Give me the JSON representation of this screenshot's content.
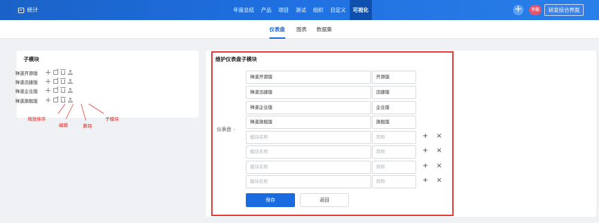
{
  "topbar": {
    "brand": "统计",
    "nav": [
      "年度总结",
      "产品",
      "项目",
      "测试",
      "组织",
      "自定义",
      "可视化"
    ],
    "active_nav": "可视化",
    "avatar": "李鹏",
    "org_button": "研发综合界面"
  },
  "subtabs": [
    "仪表盘",
    "图表",
    "数据集"
  ],
  "active_subtab": "仪表盘",
  "left_panel": {
    "title": "子模块",
    "modules": [
      "禅道开源版",
      "禅道迅捷版",
      "禅道企业版",
      "禅道旗舰版"
    ],
    "annotations": {
      "drag": "拖放排序",
      "edit": "编辑",
      "delete": "删除",
      "submodule": "子模块"
    }
  },
  "right_panel": {
    "title": "维护仪表盘子模块",
    "dashboard_label": "仪表盘",
    "rows": [
      {
        "name": "禅道开源版",
        "short": "开源版"
      },
      {
        "name": "禅道迅捷版",
        "short": "迅捷版"
      },
      {
        "name": "禅道企业版",
        "short": "企业版"
      },
      {
        "name": "禅道旗舰版",
        "short": "旗舰版"
      }
    ],
    "empty_rows": [
      {
        "name_placeholder": "模块名称",
        "short_placeholder": "简称"
      },
      {
        "name_placeholder": "模块名称",
        "short_placeholder": "简称"
      },
      {
        "name_placeholder": "模块名称",
        "short_placeholder": "简称"
      },
      {
        "name_placeholder": "模块名称",
        "short_placeholder": "简称"
      }
    ],
    "save": "保存",
    "back": "返回"
  },
  "colors": {
    "primary": "#1a6ae0",
    "annotation": "#e53935",
    "avatar": "#e0546e"
  }
}
